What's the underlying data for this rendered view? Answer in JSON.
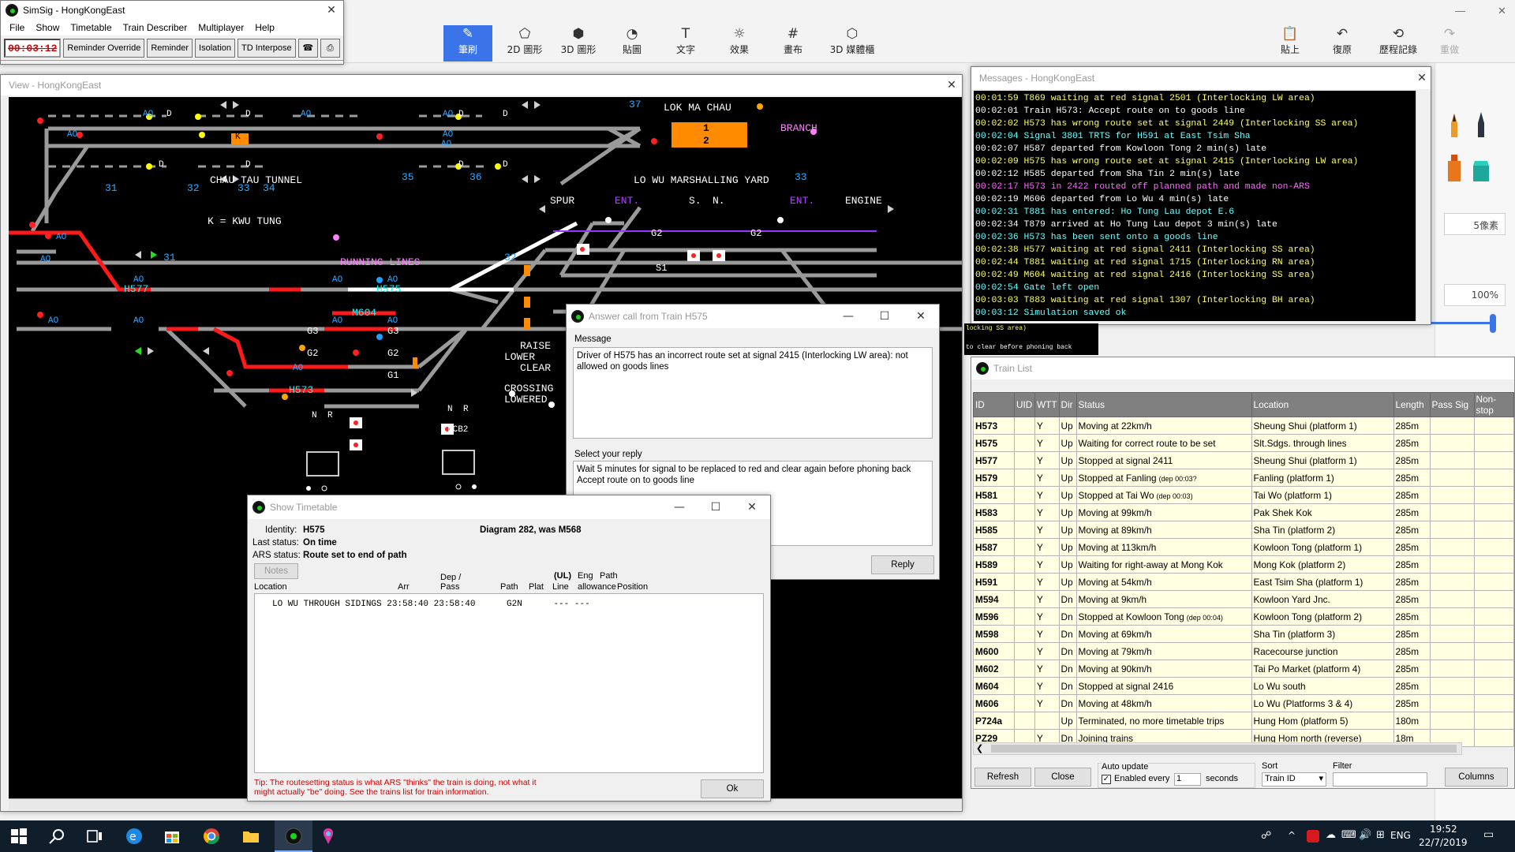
{
  "paint": {
    "tools": [
      {
        "icon": "brush-icon",
        "label": "筆刷"
      },
      {
        "icon": "2d-shape-icon",
        "label": "2D 圖形"
      },
      {
        "icon": "3d-shape-icon",
        "label": "3D 圖形"
      },
      {
        "icon": "sticker-icon",
        "label": "貼圖"
      },
      {
        "icon": "text-icon",
        "label": "文字"
      },
      {
        "icon": "effects-icon",
        "label": "效果"
      },
      {
        "icon": "canvas-icon",
        "label": "畫布"
      },
      {
        "icon": "3d-library-icon",
        "label": "3D 媒體櫃"
      }
    ],
    "right_tools": [
      {
        "icon": "paste-icon",
        "label": "貼上"
      },
      {
        "icon": "undo-icon",
        "label": "復原"
      },
      {
        "icon": "history-icon",
        "label": "歷程記錄"
      },
      {
        "icon": "redo-icon",
        "label": "重做"
      }
    ],
    "side_thickness": "5像素",
    "side_opacity": "100%"
  },
  "simsig": {
    "title": "SimSig - HongKongEast",
    "menu": [
      "File",
      "Show",
      "Timetable",
      "Train Describer",
      "Multiplayer",
      "Help"
    ],
    "clock": "00:03:12",
    "toolbar": [
      "Reminder Override",
      "Reminder",
      "Isolation",
      "TD Interpose"
    ]
  },
  "view": {
    "title": "View - HongKongEast",
    "labels": {
      "lok_ma_chau": "LOK MA CHAU",
      "branch": "BRANCH",
      "chau_tau": "CHAU TAU TUNNEL",
      "kwu_tung": "K = KWU TUNG",
      "lo_wu_yard": "LO WU MARSHALLING YARD",
      "spur": "SPUR",
      "ent1": "ENT.",
      "s": "S.",
      "n": "N.",
      "ent2": "ENT.",
      "engine": "ENGINE",
      "running_lines": "RUNNING LINES",
      "raise": "RAISE",
      "lower": "LOWER",
      "clear": "CLEAR",
      "crossing": "CROSSING",
      "lowered": "LOWERED",
      "k_box": "K",
      "box1": "1",
      "box2": "2",
      "n1": "N",
      "r1": "R",
      "n2": "N",
      "r2": "R",
      "lcb2": "LCB2",
      "g2a": "G2",
      "g2b": "G2",
      "g3a": "G3",
      "g3b": "G3",
      "g2c": "G2",
      "g2d": "G2",
      "g1": "G1",
      "s1": "S1"
    },
    "signal_numbers": [
      "37",
      "35",
      "36",
      "33",
      "31",
      "32",
      "33",
      "34",
      "31",
      "32"
    ],
    "ao_labels": [
      "AO",
      "AO",
      "AO",
      "AO",
      "AO",
      "AO",
      "AO",
      "AO",
      "AO",
      "AO",
      "AO",
      "AO",
      "AO",
      "AO",
      "AO",
      "AO"
    ],
    "d_labels": [
      "D",
      "D",
      "D",
      "D",
      "D",
      "D",
      "D",
      "D"
    ],
    "trains": [
      "H577",
      "H575",
      "M604",
      "H573"
    ]
  },
  "messages": {
    "title": "Messages - HongKongEast",
    "lines": [
      {
        "t": "00:01:59 T869 waiting at red signal 2501 (Interlocking LW area)",
        "c": "#ffff66"
      },
      {
        "t": "00:02:01 Train H573: Accept route on to goods line",
        "c": "#ffffff"
      },
      {
        "t": "00:02:02 H573 has wrong route set at signal 2449 (Interlocking SS area)",
        "c": "#ffff66"
      },
      {
        "t": "00:02:04 Signal 3801 TRTS for H591 at East Tsim Sha",
        "c": "#66ffff"
      },
      {
        "t": "00:02:07 H587 departed from Kowloon Tong 2 min(s) late",
        "c": "#ffffff"
      },
      {
        "t": "00:02:09 H575 has wrong route set at signal 2415 (Interlocking LW area)",
        "c": "#ffff66"
      },
      {
        "t": "00:02:12 H585 departed from Sha Tin 2 min(s) late",
        "c": "#ffffff"
      },
      {
        "t": "00:02:17 H573 in 2422 routed off planned path and made non-ARS",
        "c": "#ff66ff"
      },
      {
        "t": "00:02:19 M606 departed from Lo Wu 4 min(s) late",
        "c": "#ffffff"
      },
      {
        "t": "00:02:31 T881 has entered: Ho Tung Lau depot E.6",
        "c": "#66ffff"
      },
      {
        "t": "00:02:34 T879 arrived at Ho Tung Lau depot 3 min(s) late",
        "c": "#ffffff"
      },
      {
        "t": "00:02:36 H573 has been sent onto a goods line",
        "c": "#66ffff"
      },
      {
        "t": "00:02:38 H577 waiting at red signal 2411 (Interlocking SS area)",
        "c": "#ffff66"
      },
      {
        "t": "00:02:44 T881 waiting at red signal 1715 (Interlocking RN area)",
        "c": "#ffff66"
      },
      {
        "t": "00:02:49 M604 waiting at red signal 2416 (Interlocking SS area)",
        "c": "#ffff66"
      },
      {
        "t": "00:02:54 Gate left open",
        "c": "#66ffff"
      },
      {
        "t": "00:03:03 T883 waiting at red signal 1307 (Interlocking BH area)",
        "c": "#ffff66"
      },
      {
        "t": "00:03:12 Simulation saved ok",
        "c": "#66ffff"
      }
    ],
    "behind_1": "locking SS area)",
    "behind_2": "to clear before phoning back"
  },
  "train_list": {
    "title": "Train List",
    "columns": [
      "ID",
      "UID",
      "WTT",
      "Dir",
      "Status",
      "Location",
      "Length",
      "Pass Sig",
      "Non-stop"
    ],
    "rows": [
      {
        "id": "H573",
        "wtt": "Y",
        "dir": "Up",
        "status": "Moving at 22km/h",
        "loc": "Sheung Shui (platform 1)",
        "len": "285m"
      },
      {
        "id": "H575",
        "wtt": "Y",
        "dir": "Up",
        "status": "Waiting for correct route to be set",
        "loc": "Slt.Sdgs. through lines",
        "len": "285m"
      },
      {
        "id": "H577",
        "wtt": "Y",
        "dir": "Up",
        "status": "Stopped at signal 2411",
        "loc": "Sheung Shui (platform 1)",
        "len": "285m"
      },
      {
        "id": "H579",
        "wtt": "Y",
        "dir": "Up",
        "status": "Stopped at Fanling",
        "dep": "(dep 00:03?",
        "loc": "Fanling (platform 1)",
        "len": "285m"
      },
      {
        "id": "H581",
        "wtt": "Y",
        "dir": "Up",
        "status": "Stopped at Tai Wo",
        "dep": "(dep 00:03)",
        "loc": "Tai Wo (platform 1)",
        "len": "285m"
      },
      {
        "id": "H583",
        "wtt": "Y",
        "dir": "Up",
        "status": "Moving at 99km/h",
        "loc": "Pak Shek Kok",
        "len": "285m"
      },
      {
        "id": "H585",
        "wtt": "Y",
        "dir": "Up",
        "status": "Moving at 89km/h",
        "loc": "Sha Tin (platform 2)",
        "len": "285m"
      },
      {
        "id": "H587",
        "wtt": "Y",
        "dir": "Up",
        "status": "Moving at 113km/h",
        "loc": "Kowloon Tong (platform 1)",
        "len": "285m"
      },
      {
        "id": "H589",
        "wtt": "Y",
        "dir": "Up",
        "status": "Waiting for right-away at Mong Kok",
        "loc": "Mong Kok (platform 2)",
        "len": "285m"
      },
      {
        "id": "H591",
        "wtt": "Y",
        "dir": "Up",
        "status": "Moving at 54km/h",
        "loc": "East Tsim Sha (platform 1)",
        "len": "285m"
      },
      {
        "id": "M594",
        "wtt": "Y",
        "dir": "Dn",
        "status": "Moving at 9km/h",
        "loc": "Kowloon Yard Jnc.",
        "len": "285m"
      },
      {
        "id": "M596",
        "wtt": "Y",
        "dir": "Dn",
        "status": "Stopped at Kowloon Tong",
        "dep": "(dep 00:04)",
        "loc": "Kowloon Tong (platform 2)",
        "len": "285m"
      },
      {
        "id": "M598",
        "wtt": "Y",
        "dir": "Dn",
        "status": "Moving at 69km/h",
        "loc": "Sha Tin (platform 3)",
        "len": "285m"
      },
      {
        "id": "M600",
        "wtt": "Y",
        "dir": "Dn",
        "status": "Moving at 79km/h",
        "loc": "Racecourse junction",
        "len": "285m"
      },
      {
        "id": "M602",
        "wtt": "Y",
        "dir": "Dn",
        "status": "Moving at 90km/h",
        "loc": "Tai Po Market (platform 4)",
        "len": "285m"
      },
      {
        "id": "M604",
        "wtt": "Y",
        "dir": "Dn",
        "status": "Stopped at signal 2416",
        "loc": "Lo Wu south",
        "len": "285m"
      },
      {
        "id": "M606",
        "wtt": "Y",
        "dir": "Dn",
        "status": "Moving at 48km/h",
        "loc": "Lo Wu (Platforms 3 & 4)",
        "len": "285m"
      },
      {
        "id": "P724a",
        "wtt": "",
        "dir": "Up",
        "status": "Terminated, no more timetable trips",
        "loc": "Hung Hom (platform 5)",
        "len": "180m"
      },
      {
        "id": "PZ29",
        "wtt": "Y",
        "dir": "Dn",
        "status": "Joining trains",
        "loc": "Hung Hom north (reverse)",
        "len": "18m"
      }
    ],
    "refresh": "Refresh",
    "close": "Close",
    "auto_update": "Auto update",
    "enabled_every": "Enabled every",
    "every_value": "1",
    "seconds": "seconds",
    "sort": "Sort",
    "sort_value": "Train ID",
    "filter": "Filter",
    "filter_value": "",
    "columns_btn": "Columns"
  },
  "answer": {
    "title": "Answer call from Train H575",
    "message_label": "Message",
    "message": "Driver of H575 has an incorrect route set at signal 2415 (Interlocking LW area): not allowed on goods lines",
    "reply_label": "Select your reply",
    "reply_options": [
      "Wait 5 minutes for signal to be replaced to red and clear again before phoning back",
      "Accept route on to goods line"
    ],
    "reply_button": "Reply"
  },
  "timetable": {
    "title": "Show Timetable",
    "identity_label": "Identity:",
    "identity": "H575",
    "diagram": "Diagram 282, was M568",
    "last_status_label": "Last status:",
    "last_status": "On time",
    "ars_label": "ARS status:",
    "ars": "Route set to end of path",
    "notes": "Notes",
    "cols": {
      "location": "Location",
      "arr": "Arr",
      "dep": "Dep /",
      "pass": "Pass",
      "path": "Path",
      "plat": "Plat",
      "ul": "(UL)",
      "line": "Line",
      "eng": "Eng",
      "allowance": "allowance",
      "pathpos": "Path",
      "position": "Position"
    },
    "row": "LO WU THROUGH SIDINGS 23:58:40 23:58:40      G2N      --- ---",
    "tip": "Tip: The routesetting status is what ARS \"thinks\" the train is doing, not what it might actually \"be\" doing. See the trains list for train information.",
    "ok": "Ok"
  },
  "taskbar": {
    "time": "19:52",
    "date": "22/7/2019",
    "lang": "ENG"
  }
}
